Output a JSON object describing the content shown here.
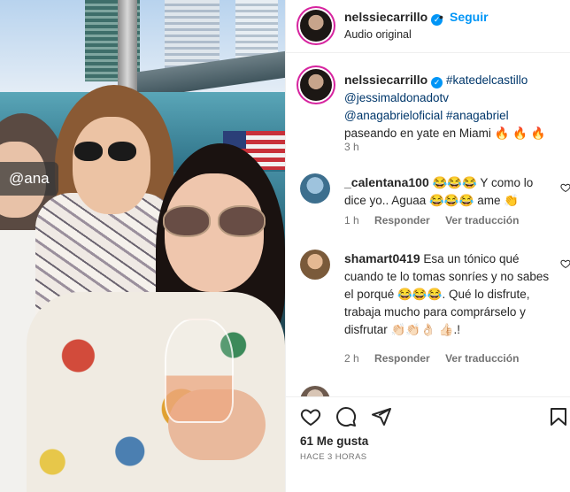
{
  "media": {
    "tag_text": "@ana"
  },
  "header": {
    "username": "nelssiecarrillo",
    "separator": "•",
    "follow_label": "Seguir",
    "audio_label": "Audio original"
  },
  "caption": {
    "username": "nelssiecarrillo",
    "hashtag_1": "#katedelcastillo",
    "mention_1": "@jessimaldonadotv",
    "mention_2": "@anagabrieloficial",
    "hashtag_2": "#anagabriel",
    "text": "paseando en yate en Miami",
    "emoji": "🔥 🔥 🔥",
    "time": "3 h"
  },
  "comments": [
    {
      "username": "_calentana100",
      "text": "😂😂😂 Y como lo dice yo.. Aguaa 😂😂😂 ame 👏",
      "time": "1 h",
      "reply_label": "Responder",
      "translate_label": "Ver traducción"
    },
    {
      "username": "shamart0419",
      "text": "Esa un tónico qué cuando te lo tomas sonríes y no sabes el porqué 😂😂😂. Qué lo disfrute, trabaja mucho para comprárselo y disfrutar 👏🏻👏🏻👌🏻 👍🏻.!",
      "time": "2 h",
      "reply_label": "Responder",
      "translate_label": "Ver traducción"
    }
  ],
  "footer": {
    "likes": "61 Me gusta",
    "time_ago": "HACE 3 HORAS"
  },
  "icons": {
    "like": "heart-icon",
    "comment": "comment-icon",
    "share": "share-icon",
    "save": "bookmark-icon",
    "verified": "verified-badge-icon"
  },
  "colors": {
    "accent": "#0095f6",
    "link": "#00376b",
    "muted": "#737373",
    "text": "#262626"
  }
}
